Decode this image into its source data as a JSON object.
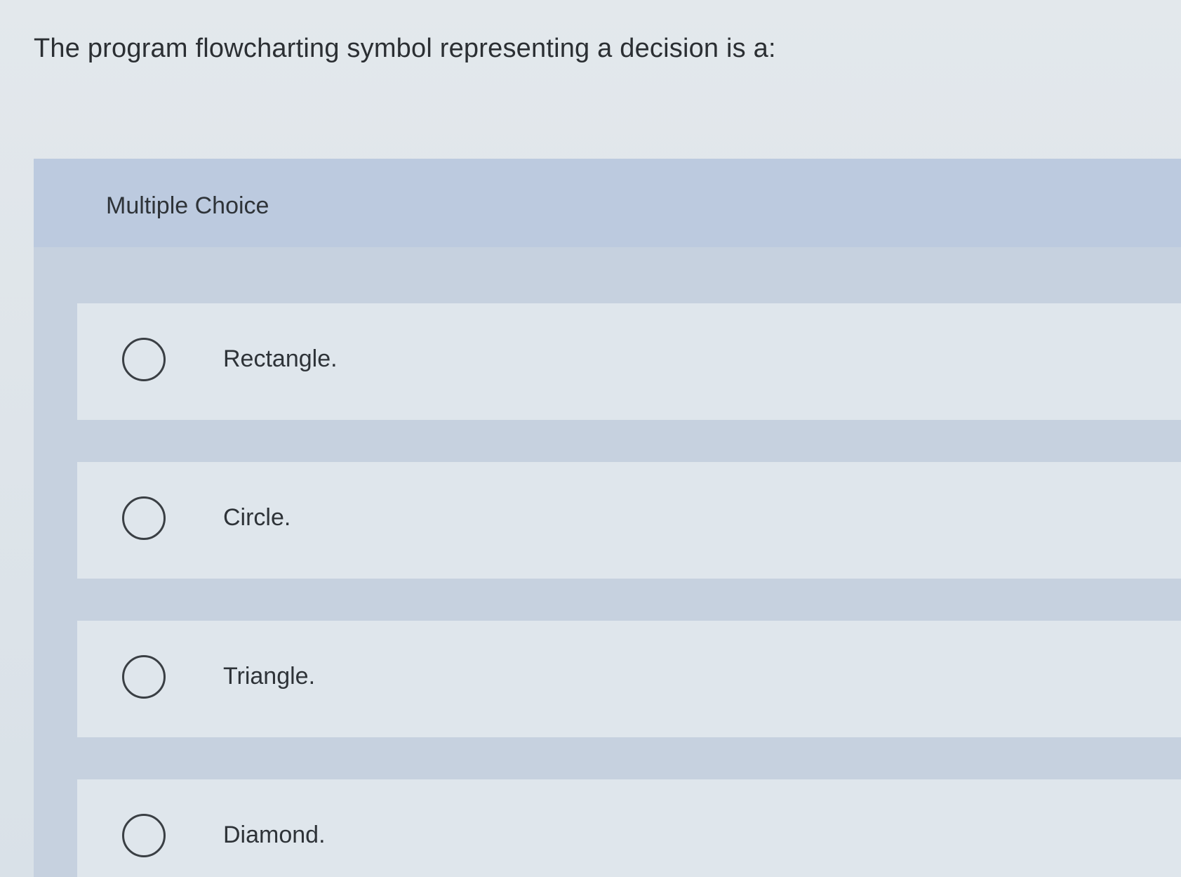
{
  "question": {
    "text": "The program flowcharting symbol representing a decision is a:"
  },
  "multiple_choice": {
    "label": "Multiple Choice",
    "options": [
      {
        "label": "Rectangle.",
        "selected": false
      },
      {
        "label": "Circle.",
        "selected": false
      },
      {
        "label": "Triangle.",
        "selected": false
      },
      {
        "label": "Diamond.",
        "selected": false
      }
    ]
  },
  "colors": {
    "page_background": "#dfe5ea",
    "header_band": "#bccadf",
    "option_background": "#dfe6ec",
    "text": "#2e3338"
  }
}
